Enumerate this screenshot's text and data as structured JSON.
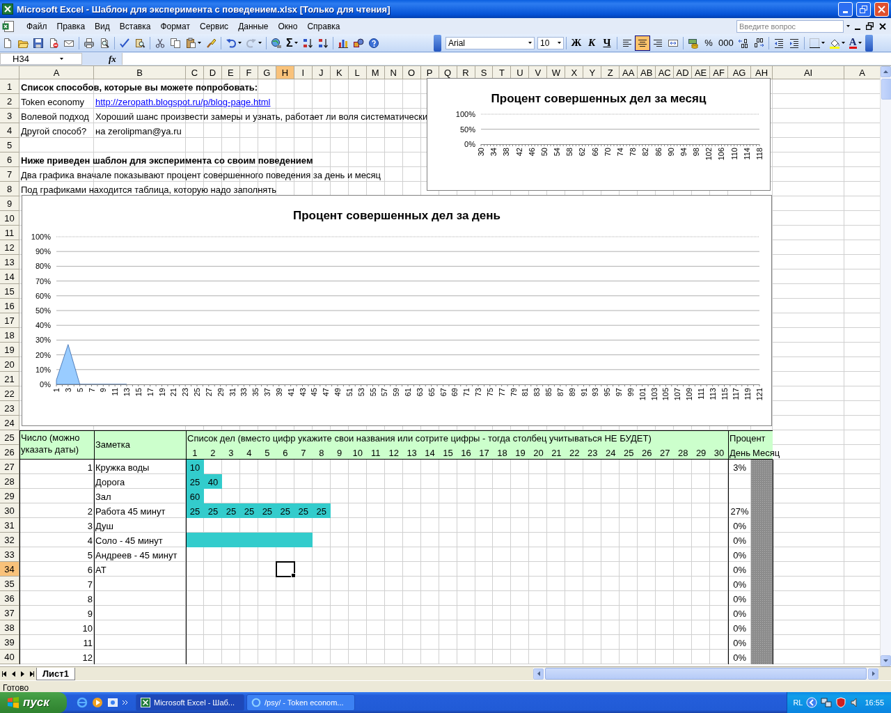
{
  "window": {
    "title": "Microsoft Excel - Шаблон для эксперимента с поведением.xlsx  [Только для чтения]"
  },
  "menu": [
    "Файл",
    "Правка",
    "Вид",
    "Вставка",
    "Формат",
    "Сервис",
    "Данные",
    "Окно",
    "Справка"
  ],
  "help_search": {
    "placeholder": "Введите вопрос"
  },
  "standard_toolbar": [
    [
      {
        "kind": "new"
      },
      {
        "kind": "open"
      },
      {
        "kind": "save"
      },
      {
        "kind": "permission"
      },
      {
        "kind": "email"
      }
    ],
    [
      {
        "kind": "print"
      },
      {
        "kind": "preview"
      }
    ],
    [
      {
        "kind": "spell"
      },
      {
        "kind": "research"
      }
    ],
    [
      {
        "kind": "cut"
      },
      {
        "kind": "copy"
      },
      {
        "kind": "paste"
      },
      {
        "kind": "painter"
      }
    ],
    [
      {
        "kind": "undo"
      },
      {
        "kind": "redo"
      }
    ],
    [
      {
        "kind": "hyperlink"
      },
      {
        "kind": "sum",
        "label": "Σ"
      },
      {
        "kind": "sort-asc"
      },
      {
        "kind": "sort-desc"
      }
    ],
    [
      {
        "kind": "chart"
      },
      {
        "kind": "drawing"
      },
      {
        "kind": "help"
      }
    ]
  ],
  "formatting_toolbar": {
    "font": "Arial",
    "size": "10",
    "groups": [
      [
        {
          "kind": "bold",
          "label": "Ж"
        },
        {
          "kind": "italic",
          "label": "К"
        },
        {
          "kind": "underline",
          "label": "Ч"
        }
      ],
      [
        {
          "kind": "align-left",
          "selected": false
        },
        {
          "kind": "align-center",
          "selected": true
        },
        {
          "kind": "align-right",
          "selected": false
        },
        {
          "kind": "merge"
        }
      ],
      [
        {
          "kind": "currency"
        },
        {
          "kind": "percent",
          "label": "%"
        },
        {
          "kind": "thousands",
          "label": "000"
        },
        {
          "kind": "inc-decimal"
        },
        {
          "kind": "dec-decimal"
        }
      ],
      [
        {
          "kind": "outdent"
        },
        {
          "kind": "indent"
        }
      ],
      [
        {
          "kind": "borders"
        },
        {
          "kind": "fill"
        },
        {
          "kind": "font-color",
          "label": "A"
        }
      ]
    ]
  },
  "formula_bar": {
    "name_box": "H34",
    "function_label": "fx"
  },
  "columns": [
    {
      "label": "A",
      "selected": false
    },
    {
      "label": "B",
      "selected": false
    },
    {
      "label": "C",
      "selected": false
    },
    {
      "label": "D",
      "selected": false
    },
    {
      "label": "E",
      "selected": false
    },
    {
      "label": "F",
      "selected": false
    },
    {
      "label": "G",
      "selected": false
    },
    {
      "label": "H",
      "selected": true
    },
    {
      "label": "I",
      "selected": false
    },
    {
      "label": "J",
      "selected": false
    },
    {
      "label": "K",
      "selected": false
    },
    {
      "label": "L",
      "selected": false
    },
    {
      "label": "M",
      "selected": false
    },
    {
      "label": "N",
      "selected": false
    },
    {
      "label": "O",
      "selected": false
    },
    {
      "label": "P",
      "selected": false
    },
    {
      "label": "Q",
      "selected": false
    },
    {
      "label": "R",
      "selected": false
    },
    {
      "label": "S",
      "selected": false
    },
    {
      "label": "T",
      "selected": false
    },
    {
      "label": "U",
      "selected": false
    },
    {
      "label": "V",
      "selected": false
    },
    {
      "label": "W",
      "selected": false
    },
    {
      "label": "X",
      "selected": false
    },
    {
      "label": "Y",
      "selected": false
    },
    {
      "label": "Z",
      "selected": false
    },
    {
      "label": "AA",
      "selected": false
    },
    {
      "label": "AB",
      "selected": false
    },
    {
      "label": "AC",
      "selected": false
    },
    {
      "label": "AD",
      "selected": false
    },
    {
      "label": "AE",
      "selected": false
    },
    {
      "label": "AF",
      "selected": false
    },
    {
      "label": "AG",
      "selected": false
    },
    {
      "label": "AH",
      "selected": false
    },
    {
      "label": "AI",
      "selected": false
    },
    {
      "label": "A",
      "selected": false
    }
  ],
  "rows": [
    {
      "label": "1",
      "selected": false
    },
    {
      "label": "2",
      "selected": false
    },
    {
      "label": "3",
      "selected": false
    },
    {
      "label": "4",
      "selected": false
    },
    {
      "label": "5",
      "selected": false
    },
    {
      "label": "6",
      "selected": false
    },
    {
      "label": "7",
      "selected": false
    },
    {
      "label": "8",
      "selected": false
    },
    {
      "label": "9",
      "selected": false
    },
    {
      "label": "10",
      "selected": false
    },
    {
      "label": "11",
      "selected": false
    },
    {
      "label": "12",
      "selected": false
    },
    {
      "label": "13",
      "selected": false
    },
    {
      "label": "14",
      "selected": false
    },
    {
      "label": "15",
      "selected": false
    },
    {
      "label": "16",
      "selected": false
    },
    {
      "label": "17",
      "selected": false
    },
    {
      "label": "18",
      "selected": false
    },
    {
      "label": "19",
      "selected": false
    },
    {
      "label": "20",
      "selected": false
    },
    {
      "label": "21",
      "selected": false
    },
    {
      "label": "22",
      "selected": false
    },
    {
      "label": "23",
      "selected": false
    },
    {
      "label": "24",
      "selected": false
    },
    {
      "label": "25",
      "selected": false
    },
    {
      "label": "26",
      "selected": false
    },
    {
      "label": "27",
      "selected": false
    },
    {
      "label": "28",
      "selected": false
    },
    {
      "label": "29",
      "selected": false
    },
    {
      "label": "30",
      "selected": false
    },
    {
      "label": "31",
      "selected": false
    },
    {
      "label": "32",
      "selected": false
    },
    {
      "label": "33",
      "selected": false
    },
    {
      "label": "34",
      "selected": true
    },
    {
      "label": "35",
      "selected": false
    },
    {
      "label": "36",
      "selected": false
    },
    {
      "label": "37",
      "selected": false
    },
    {
      "label": "38",
      "selected": false
    },
    {
      "label": "39",
      "selected": false
    },
    {
      "label": "40",
      "selected": false
    }
  ],
  "intro": {
    "methods_heading": "Список способов, которые вы можете попробовать:",
    "methods": [
      {
        "name": "Token economy",
        "note": "http://zeropath.blogspot.ru/p/blog-page.html",
        "kind": "link"
      },
      {
        "name": "Волевой подход",
        "note": "Хороший шанс произвести замеры и узнать, работает ли воля систематически",
        "kind": "text"
      },
      {
        "name": "Другой способ?",
        "note": "на zerolipman@ya.ru",
        "kind": "text"
      }
    ],
    "template_heading": "Ниже приведен шаблон для эксперимента со своим поведением",
    "template_notes": [
      "Два графика вначале показывают процент совершенного поведения за день и месяц",
      "Под графиками находится таблица, которую надо заполнять"
    ]
  },
  "charts": [
    {
      "chart_data": {
        "type": "area",
        "title": "Процент совершенных дел за месяц",
        "grid": true,
        "categories": [
          "30",
          "34",
          "38",
          "42",
          "46",
          "50",
          "54",
          "58",
          "62",
          "66",
          "70",
          "74",
          "78",
          "82",
          "86",
          "90",
          "94",
          "98",
          "102",
          "106",
          "110",
          "114",
          "118"
        ],
        "series": [
          {
            "values": [
              null,
              null,
              null,
              null,
              null,
              null,
              null,
              null,
              null,
              null,
              null,
              null,
              null,
              null,
              null,
              null,
              null,
              null,
              null,
              null,
              null,
              null,
              null
            ]
          }
        ],
        "ylim": [
          0,
          1
        ],
        "yticks": [
          {
            "value": 0,
            "label": "0%"
          },
          {
            "value": 0.5,
            "label": "50%"
          },
          {
            "value": 1,
            "label": "100%"
          }
        ]
      }
    },
    {
      "chart_data": {
        "type": "area",
        "title": "Процент совершенных дел за день",
        "grid": true,
        "categories": [
          "1",
          "3",
          "5",
          "7",
          "9",
          "11",
          "13",
          "15",
          "17",
          "19",
          "21",
          "23",
          "25",
          "27",
          "29",
          "31",
          "33",
          "35",
          "37",
          "39",
          "41",
          "43",
          "45",
          "47",
          "49",
          "51",
          "53",
          "55",
          "57",
          "59",
          "61",
          "63",
          "65",
          "67",
          "69",
          "71",
          "73",
          "75",
          "77",
          "79",
          "81",
          "83",
          "85",
          "87",
          "89",
          "91",
          "93",
          "95",
          "97",
          "99",
          "101",
          "103",
          "105",
          "107",
          "109",
          "111",
          "113",
          "115",
          "117",
          "119",
          "121"
        ],
        "series": [
          {
            "color": "#99ccff",
            "values": [
              0.03,
              0.27,
              0,
              0,
              0,
              0,
              0,
              null,
              null,
              null,
              null,
              null,
              null,
              null,
              null,
              null,
              null,
              null,
              null,
              null,
              null,
              null,
              null,
              null,
              null,
              null,
              null,
              null,
              null,
              null,
              null,
              null,
              null,
              null,
              null,
              null,
              null,
              null,
              null,
              null,
              null,
              null,
              null,
              null,
              null,
              null,
              null,
              null,
              null,
              null,
              null,
              null,
              null,
              null,
              null,
              null,
              null,
              null,
              null,
              null,
              null
            ]
          }
        ],
        "ylim": [
          0,
          1
        ],
        "yticks": [
          {
            "value": 0,
            "label": "0%"
          },
          {
            "value": 0.1,
            "label": "10%"
          },
          {
            "value": 0.2,
            "label": "20%"
          },
          {
            "value": 0.3,
            "label": "30%"
          },
          {
            "value": 0.4,
            "label": "40%"
          },
          {
            "value": 0.5,
            "label": "50%"
          },
          {
            "value": 0.6,
            "label": "60%"
          },
          {
            "value": 0.7,
            "label": "70%"
          },
          {
            "value": 0.8,
            "label": "80%"
          },
          {
            "value": 0.9,
            "label": "90%"
          },
          {
            "value": 1,
            "label": "100%"
          }
        ]
      }
    }
  ],
  "table": {
    "number_header": "Число (можно указать даты)",
    "note_header": "Заметка",
    "tasks_header": "Список дел (вместо цифр укажите свои названия или сотрите цифры - тогда столбец учитываться НЕ БУДЕТ)",
    "task_numbers": [
      "1",
      "2",
      "3",
      "4",
      "5",
      "6",
      "7",
      "8",
      "9",
      "10",
      "11",
      "12",
      "13",
      "14",
      "15",
      "16",
      "17",
      "18",
      "19",
      "20",
      "21",
      "22",
      "23",
      "24",
      "25",
      "26",
      "27",
      "28",
      "29",
      "30"
    ],
    "percent_header": "Процент",
    "day_header": "День",
    "month_header": "Месяц",
    "month_shaded": true,
    "rows": [
      {
        "number": "1",
        "note": "Кружка воды",
        "tasks": [
          {
            "value": "10",
            "filled": true
          }
        ],
        "day_percent": "3%"
      },
      {
        "note": "Дорога",
        "tasks": [
          {
            "value": "25",
            "filled": true
          },
          {
            "value": "40",
            "filled": true
          }
        ]
      },
      {
        "note": "Зал",
        "tasks": [
          {
            "value": "60",
            "filled": true
          }
        ]
      },
      {
        "number": "2",
        "note": "Работа 45 минут",
        "tasks": [
          {
            "value": "25",
            "filled": true
          },
          {
            "value": "25",
            "filled": true
          },
          {
            "value": "25",
            "filled": true
          },
          {
            "value": "25",
            "filled": true
          },
          {
            "value": "25",
            "filled": true
          },
          {
            "value": "25",
            "filled": true
          },
          {
            "value": "25",
            "filled": true
          },
          {
            "value": "25",
            "filled": true
          }
        ],
        "day_percent": "27%"
      },
      {
        "number": "3",
        "note": "Душ",
        "day_percent": "0%"
      },
      {
        "number": "4",
        "note": "Соло - 45 минут",
        "tasks": [
          {
            "filled": true
          },
          {
            "filled": true
          },
          {
            "filled": true
          },
          {
            "filled": true
          },
          {
            "filled": true
          },
          {
            "filled": true
          },
          {
            "filled": true
          }
        ],
        "day_percent": "0%"
      },
      {
        "number": "5",
        "note": "Андреев - 45 минут",
        "day_percent": "0%"
      },
      {
        "number": "6",
        "note": "АТ",
        "day_percent": "0%"
      },
      {
        "number": "7",
        "day_percent": "0%"
      },
      {
        "number": "8",
        "day_percent": "0%"
      },
      {
        "number": "9",
        "day_percent": "0%"
      },
      {
        "number": "10",
        "day_percent": "0%"
      },
      {
        "number": "11",
        "day_percent": "0%"
      },
      {
        "number": "12",
        "day_percent": "0%"
      }
    ]
  },
  "sheet_tabs": [
    {
      "label": "Лист1",
      "selected": true
    }
  ],
  "status_bar": {
    "text": "Готово"
  },
  "taskbar": {
    "start": "пуск",
    "tasks": [
      {
        "label": "Microsoft Excel - Шаб...",
        "selected": true
      },
      {
        "label": "/psy/ - Token econom...",
        "selected": false
      }
    ],
    "language": "RL",
    "clock": "16:55"
  }
}
